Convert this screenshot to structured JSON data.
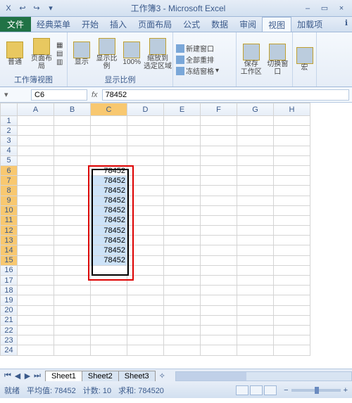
{
  "title": "工作簿3 - Microsoft Excel",
  "window_buttons": {
    "min": "–",
    "max": "▭",
    "close": "×"
  },
  "qat": [
    "X",
    "↩",
    "↪",
    "▾"
  ],
  "menu": {
    "file": "文件",
    "tabs": [
      "经典菜单",
      "开始",
      "插入",
      "页面布局",
      "公式",
      "数据",
      "审阅",
      "视图",
      "加载项"
    ],
    "active": "视图",
    "help": "ℹ"
  },
  "ribbon": {
    "group1": {
      "label": "工作簿视图",
      "items": {
        "normal": "普通",
        "pagelayout": "页面布局",
        "extra": [
          "▦",
          "▤",
          "▥"
        ]
      }
    },
    "group2": {
      "label": "显示比例",
      "items": {
        "show": "显示",
        "zoom": "显示比例",
        "hundred": "100%",
        "zoomsel": "缩放到\n选定区域"
      }
    },
    "group3": {
      "items": {
        "newwin": "新建窗口",
        "arrange": "全部重排",
        "freeze": "冻结窗格"
      }
    },
    "group4": {
      "items": {
        "save": "保存\n工作区",
        "switch": "切换窗口"
      }
    },
    "group5": {
      "items": {
        "macro": "宏"
      }
    }
  },
  "namebox": {
    "ref": "C6",
    "fx": "fx"
  },
  "formula_bar": "78452",
  "columns": [
    "A",
    "B",
    "C",
    "D",
    "E",
    "F",
    "G",
    "H"
  ],
  "rows_shown": 24,
  "selection": {
    "col": "C",
    "top_row": 6,
    "bottom_row": 15,
    "value": "78452"
  },
  "cells": {
    "C6": "78452",
    "C7": "78452",
    "C8": "78452",
    "C9": "78452",
    "C10": "78452",
    "C11": "78452",
    "C12": "78452",
    "C13": "78452",
    "C14": "78452",
    "C15": "78452"
  },
  "chart_data": null,
  "sheets": {
    "active": "Sheet1",
    "list": [
      "Sheet1",
      "Sheet2",
      "Sheet3"
    ]
  },
  "status": {
    "mode": "就绪",
    "avg_label": "平均值:",
    "avg": "78452",
    "count_label": "计数:",
    "count": "10",
    "sum_label": "求和:",
    "sum": "784520",
    "zoom_minus": "−",
    "zoom_plus": "+"
  }
}
